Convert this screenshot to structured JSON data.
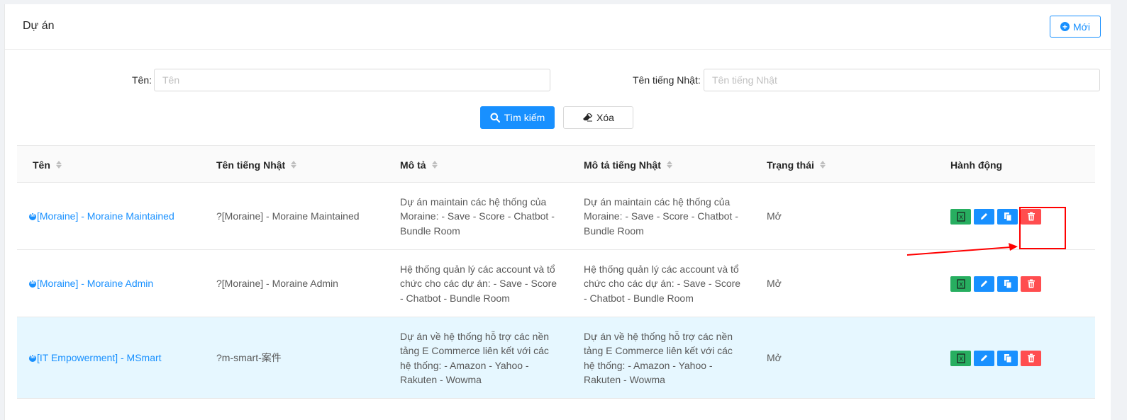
{
  "page": {
    "title": "Dự án",
    "new_button": "Mới"
  },
  "search": {
    "name_label": "Tên:",
    "name_placeholder": "Tên",
    "jp_label": "Tên tiếng Nhật:",
    "jp_placeholder": "Tên tiếng Nhật",
    "search_button": "Tìm kiếm",
    "clear_button": "Xóa"
  },
  "table": {
    "headers": {
      "name": "Tên",
      "name_jp": "Tên tiếng Nhật",
      "desc": "Mô tả",
      "desc_jp": "Mô tả tiếng Nhật",
      "status": "Trạng thái",
      "actions": "Hành động"
    },
    "rows": [
      {
        "name": "[Moraine] - Moraine Maintained",
        "name_jp": "?[Moraine] - Moraine Maintained",
        "desc": "Dự án maintain các hệ thống của Moraine: - Save - Score - Chatbot - Bundle Room",
        "desc_jp": "Dự án maintain các hệ thống của Moraine: - Save - Score - Chatbot - Bundle Room",
        "status": "Mở"
      },
      {
        "name": "[Moraine] - Moraine Admin",
        "name_jp": "?[Moraine] - Moraine Admin",
        "desc": "Hệ thống quản lý các account và tổ chức cho các dự án: - Save - Score - Chatbot - Bundle Room",
        "desc_jp": "Hệ thống quản lý các account và tổ chức cho các dự án: - Save - Score - Chatbot - Bundle Room",
        "status": "Mở"
      },
      {
        "name": "[IT Empowerment] - MSmart",
        "name_jp": "?m-smart-案件",
        "desc": "Dự án về hệ thống hỗ trợ các nền tảng E Commerce liên kết với các hệ thống: - Amazon - Yahoo - Rakuten - Wowma",
        "desc_jp": "Dự án về hệ thống hỗ trợ các nền tảng E Commerce liên kết với các hệ thống: - Amazon - Yahoo - Rakuten - Wowma",
        "status": "Mở"
      }
    ],
    "row_icons": [
      "excel-export-icon",
      "edit-icon",
      "copy-icon",
      "delete-icon"
    ]
  },
  "colors": {
    "primary": "#1890ff",
    "success": "#27ae60",
    "danger": "#ff4d4f",
    "row_highlight": "#e6f7ff",
    "annotation": "#ff0000"
  }
}
